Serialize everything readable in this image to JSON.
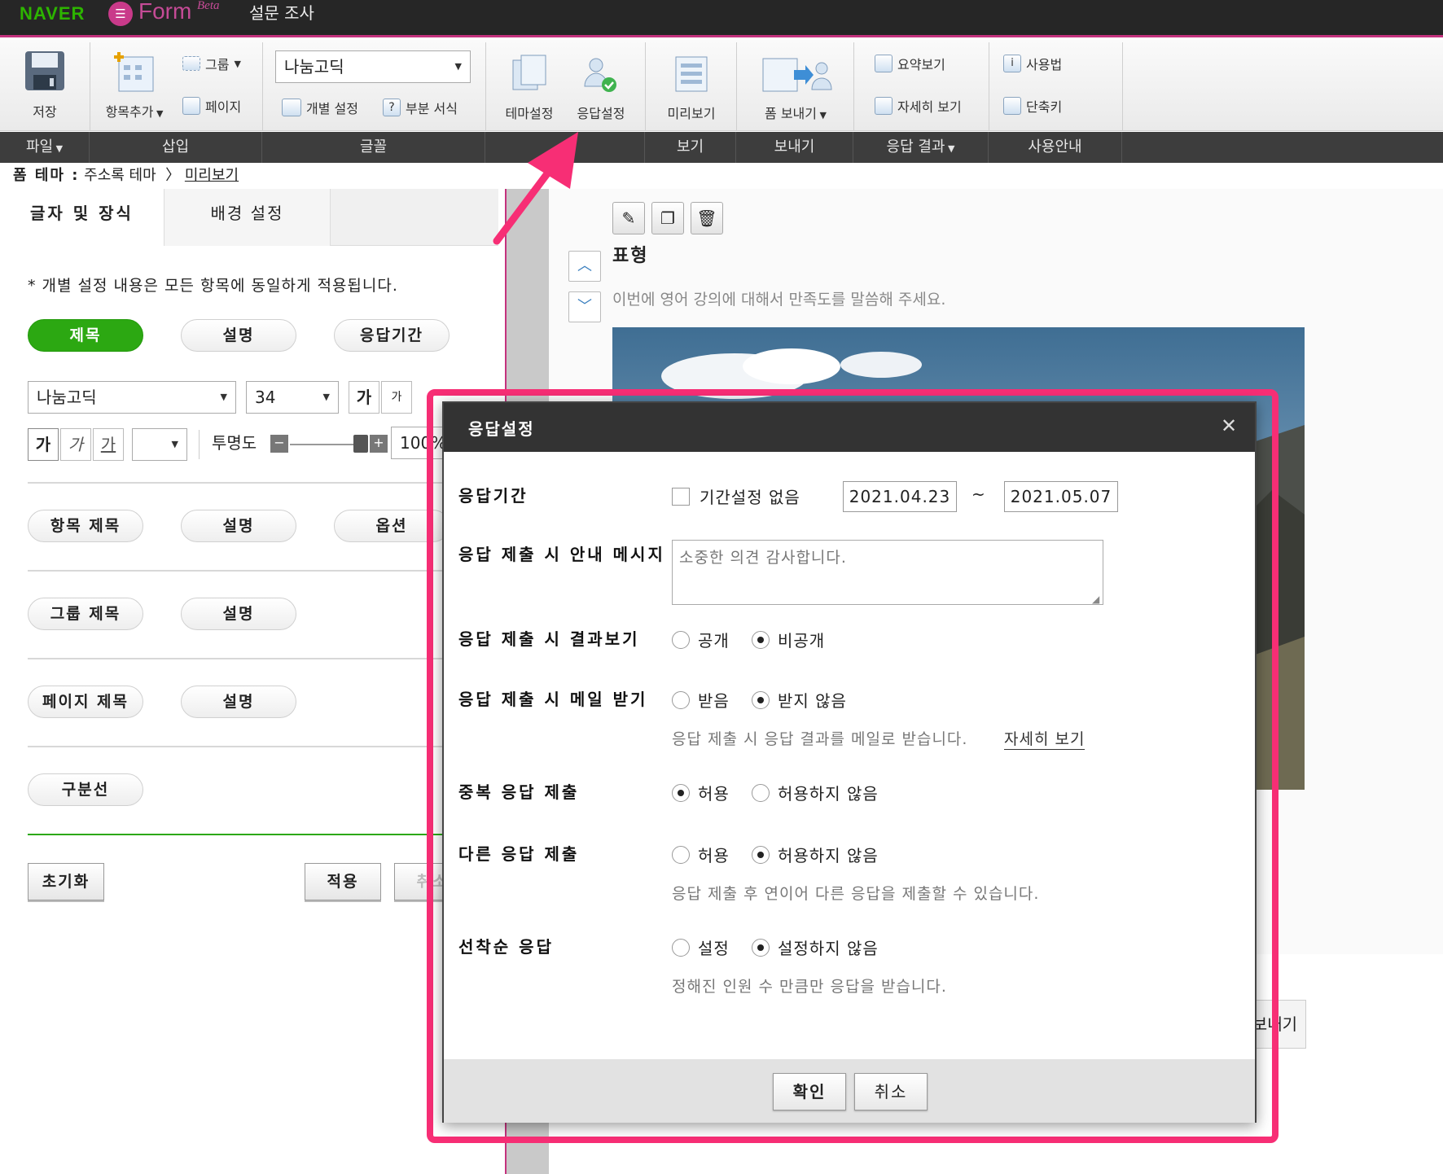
{
  "colors": {
    "accent_pink": "#f72e75",
    "naver_green": "#2db400",
    "form_purple": "#c54b96",
    "active_pill": "#2ca812"
  },
  "topbar": {
    "naver": "NAVER",
    "form": "Form",
    "beta": "Beta",
    "title": "설문 조사"
  },
  "ribbon": {
    "save": "저장",
    "add_item": "항목추가",
    "group": "그룹",
    "page": "페이지",
    "font_select": "나눔고딕",
    "individual_setting": "개별 설정",
    "partial_format": "부분 서식",
    "theme_setting": "테마설정",
    "response_setting": "응답설정",
    "preview": "미리보기",
    "send_form": "폼 보내기",
    "summary_view": "요약보기",
    "detail_view": "자세히 보기",
    "usage": "사용법",
    "shortcut": "단축키"
  },
  "sections": {
    "file": "파일",
    "insert": "삽입",
    "font": "글꼴",
    "view": "보기",
    "send": "보내기",
    "results": "응답 결과",
    "guide": "사용안내"
  },
  "breadcrumb": {
    "label": "폼 테마 :",
    "theme": "주소록 테마",
    "sep": "〉",
    "current": "미리보기"
  },
  "left": {
    "tab_font": "글자 및 장식",
    "tab_bg": "배경 설정",
    "notice": "* 개별 설정 내용은 모든 항목에 동일하게 적용됩니다.",
    "pill_title": "제목",
    "pill_desc": "설명",
    "pill_period": "응답기간",
    "font_name": "나눔고딕",
    "font_size": "34",
    "grow": "가",
    "shrink": "가",
    "bold": "가",
    "italic": "가",
    "underline": "가",
    "opacity_label": "투명도",
    "opacity_value": "100%",
    "opacity_level": 1.0,
    "pill_item_title": "항목 제목",
    "pill_item_desc": "설명",
    "pill_option": "옵션",
    "pill_group_title": "그룹 제목",
    "pill_group_desc": "설명",
    "pill_page_title": "페이지 제목",
    "pill_page_desc": "설명",
    "pill_divider": "구분선",
    "btn_reset": "초기화",
    "btn_apply": "적용",
    "btn_cancel": "취소"
  },
  "preview": {
    "icons": [
      "pencil-icon",
      "copy-icon",
      "trash-icon"
    ],
    "question_title": "표형",
    "question_desc": "이번에 영어 강의에 대해서 만족도를 말씀해 주세요.",
    "hidden_button": "보내기"
  },
  "modal": {
    "title": "응답설정",
    "close": "✕",
    "period_label": "응답기간",
    "no_period": "기간설정 없음",
    "no_period_checked": false,
    "start_date": "2021.04.23",
    "tilde": "~",
    "end_date": "2021.05.07",
    "message_label": "응답 제출 시 안내 메시지",
    "message_value": "소중한 의견 감사합니다.",
    "result_label": "응답 제출 시 결과보기",
    "result_options": [
      "공개",
      "비공개"
    ],
    "result_selected": "비공개",
    "mail_label": "응답 제출 시 메일 받기",
    "mail_options": [
      "받음",
      "받지 않음"
    ],
    "mail_selected": "받지 않음",
    "mail_help": "응답 제출 시 응답 결과를 메일로 받습니다.",
    "mail_help_link": "자세히 보기",
    "dup_label": "중복 응답 제출",
    "dup_options": [
      "허용",
      "허용하지 않음"
    ],
    "dup_selected": "허용",
    "other_label": "다른 응답 제출",
    "other_options": [
      "허용",
      "허용하지 않음"
    ],
    "other_selected": "허용하지 않음",
    "other_help": "응답 제출 후 연이어 다른 응답을 제출할 수 있습니다.",
    "first_label": "선착순 응답",
    "first_options": [
      "설정",
      "설정하지 않음"
    ],
    "first_selected": "설정하지 않음",
    "first_help": "정해진 인원 수 만큼만 응답을 받습니다.",
    "ok": "확인",
    "cancel": "취소"
  }
}
